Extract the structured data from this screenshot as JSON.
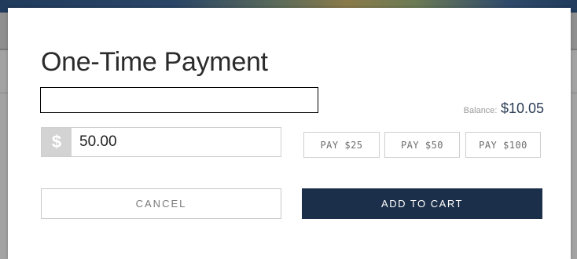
{
  "modal": {
    "title": "One-Time Payment",
    "balance_label": "Balance:",
    "balance_value": "$10.05",
    "currency_symbol": "$",
    "amount_value": "50.00",
    "quick_pay": [
      {
        "label": "PAY $25"
      },
      {
        "label": "PAY $50"
      },
      {
        "label": "PAY $100"
      }
    ],
    "cancel_label": "CANCEL",
    "add_to_cart_label": "ADD TO CART"
  },
  "colors": {
    "primary": "#1c2f4a",
    "balance_text": "#2b3d55",
    "border": "#cfcfcf"
  }
}
